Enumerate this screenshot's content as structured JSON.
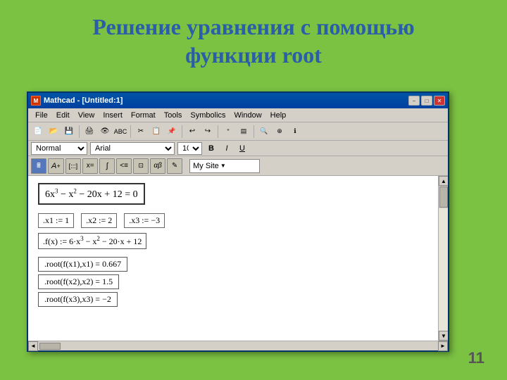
{
  "slide": {
    "title": "Решение уравнения с помощью функции root",
    "page_number": "11",
    "bg_color": "#7bc142"
  },
  "window": {
    "title_bar": "Mathcad - [Untitled:1]",
    "icon_label": "M",
    "buttons": {
      "minimize": "−",
      "maximize": "□",
      "close": "✕"
    }
  },
  "menu": {
    "items": [
      "File",
      "Edit",
      "View",
      "Insert",
      "Format",
      "Tools",
      "Symbolics",
      "Window",
      "Help"
    ]
  },
  "format_bar": {
    "style": "Normal",
    "font": "Arial",
    "size": "10",
    "bold": "B",
    "italic": "I",
    "underline": "U"
  },
  "math_toolbar": {
    "buttons": [
      "A+",
      "[:::]",
      "x=",
      "∫≶",
      "<≡",
      "⊡",
      "αβ",
      "✎"
    ],
    "my_site_label": "My Site"
  },
  "content": {
    "main_equation": "6x³ − x² − 20x + 12 = 0",
    "assignments": [
      ".x1 := 1",
      ".x2 := 2",
      ".x3 := −3"
    ],
    "function_def": ".f(x) := 6·x³ − x² − 20·x + 12",
    "root_results": [
      ".root(f(x1),x1) = 0.667",
      ".root(f(x2),x2) = 1.5",
      ".root(f(x3),x3) = −2"
    ]
  }
}
